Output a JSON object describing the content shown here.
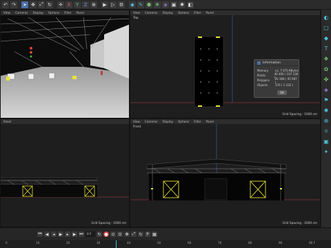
{
  "toolbar": {
    "icons": [
      "undo-icon",
      "redo-icon",
      "select-icon",
      "move-icon",
      "scale-icon",
      "rotate-icon",
      "axis-icon",
      "x-axis-icon",
      "y-axis-icon",
      "z-axis-icon",
      "coordinate-system-icon",
      "render-view-icon",
      "render-active-icon",
      "render-settings-icon",
      "cube-icon",
      "pen-icon",
      "subdivision-icon",
      "cloner-icon",
      "deformer-icon",
      "camera-icon",
      "light-icon",
      "tag-icon"
    ]
  },
  "rightbar": {
    "icons": [
      "make-editable-icon",
      "object-mode-icon",
      "polygon-mode-icon",
      "edge-mode-icon",
      "point-mode-icon",
      "texture-mode-icon",
      "axis-mode-icon",
      "snap-icon",
      "workplane-icon",
      "lock-icon",
      "camera-lock-icon",
      "solo-icon",
      "viewport-solo-icon",
      "grid-icon"
    ]
  },
  "viewports": {
    "perspective": {
      "grid_spacing": "Grid Spacing : 10000 cm"
    },
    "top": {
      "menu": [
        "View",
        "Cameras",
        "Display",
        "Options",
        "Filter",
        "Panel"
      ],
      "name": "Top",
      "grid_spacing": "Grid Spacing : 1000 cm"
    },
    "right": {
      "menu": [
        "Panel"
      ],
      "name": "Panel",
      "grid_spacing": "Grid Spacing : 1000 cm"
    },
    "front": {
      "menu": [
        "View",
        "Cameras",
        "Display",
        "Options",
        "Filter",
        "Panel"
      ],
      "name": "Front",
      "grid_spacing": "Grid Spacing : 1000 cm"
    }
  },
  "perspective_menu": {
    "items": [
      "View",
      "Cameras",
      "Display",
      "Options",
      "Filter",
      "Panel"
    ]
  },
  "info_dialog": {
    "title": "Information",
    "rows": [
      {
        "key": "Memory",
        "value": "ca. 7 070 KBytes"
      },
      {
        "key": "Points",
        "value": "40 460 ( 107 136 )"
      },
      {
        "key": "Polygons",
        "value": "20 368 ( 95 987 )"
      },
      {
        "key": "Objects",
        "value": "376 ( 1 332 )"
      }
    ],
    "ok_label": "OK"
  },
  "timeline": {
    "current_frame": "0 F",
    "ticks": [
      "0",
      "10",
      "20",
      "30",
      "40",
      "50",
      "60",
      "70",
      "80",
      "90"
    ],
    "end_frame": "90 F"
  },
  "colors": {
    "accent": "#4dc0d9",
    "record": "#d94545",
    "highlight": "#4a6fa5",
    "selection_yellow": "#e8e337"
  }
}
